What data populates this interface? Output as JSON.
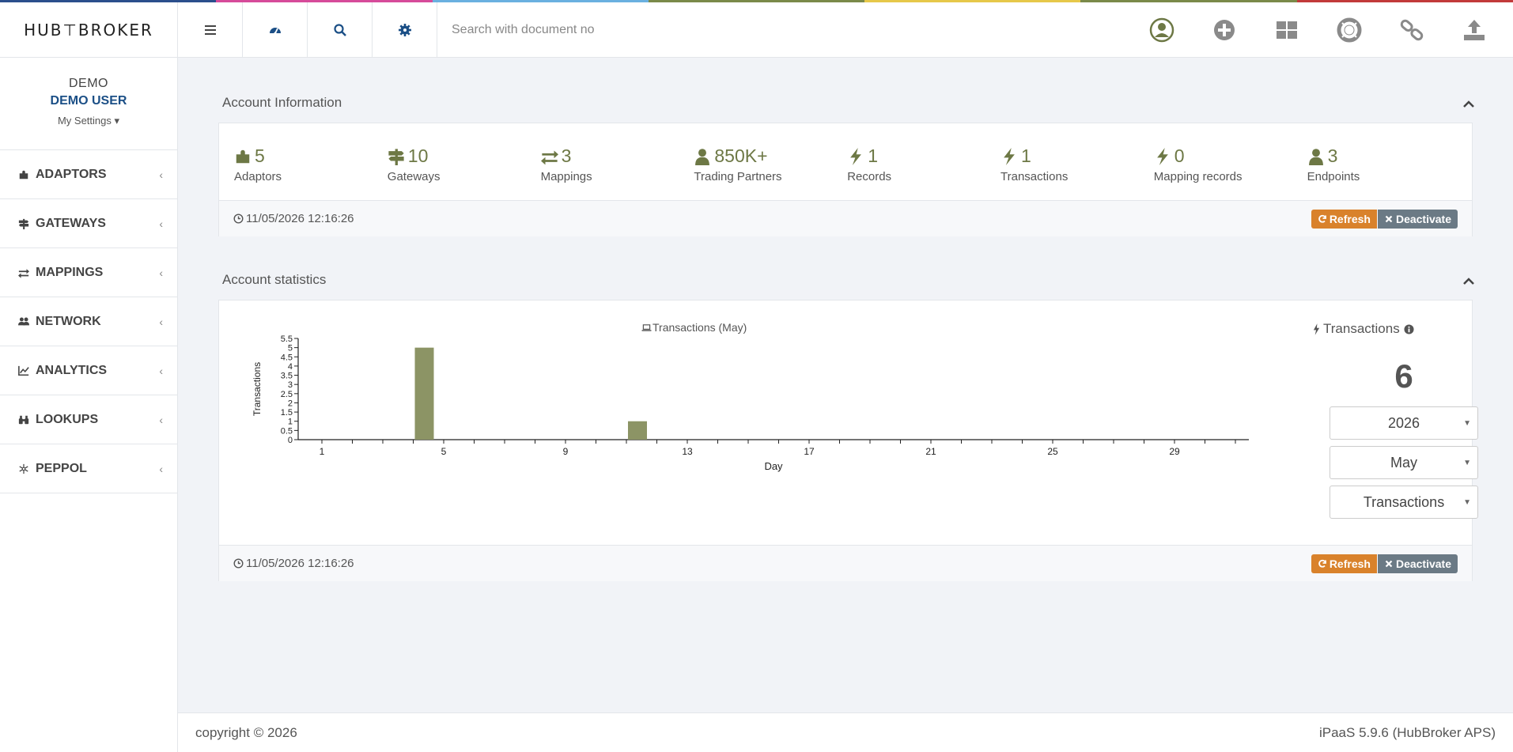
{
  "brand": {
    "logo_text": "HUB⊤BROKER"
  },
  "top_strip_colors": [
    "#2b4f8c",
    "#d64b9a",
    "#6ab0e0",
    "#7a8a4a",
    "#e6c84a",
    "#7a8a4a",
    "#c23a3a"
  ],
  "header": {
    "search_placeholder": "Search with document no",
    "left_icons": [
      "menu-icon",
      "dashboard-icon",
      "search-icon",
      "gear-icon"
    ],
    "right_icons": [
      "user-circle-icon",
      "add-circle-icon",
      "dashboard-grid-icon",
      "lifesaver-icon",
      "link-icon",
      "upload-icon"
    ]
  },
  "user": {
    "org": "DEMO",
    "name": "DEMO USER",
    "settings": "My Settings"
  },
  "sidebar": {
    "items": [
      {
        "label": "ADAPTORS",
        "icon": "puzzle-icon"
      },
      {
        "label": "GATEWAYS",
        "icon": "signpost-icon"
      },
      {
        "label": "MAPPINGS",
        "icon": "exchange-icon"
      },
      {
        "label": "NETWORK",
        "icon": "users-icon"
      },
      {
        "label": "ANALYTICS",
        "icon": "line-chart-icon"
      },
      {
        "label": "LOOKUPS",
        "icon": "binoculars-icon"
      },
      {
        "label": "PEPPOL",
        "icon": "snowflake-icon"
      }
    ]
  },
  "account_info": {
    "title": "Account Information",
    "stats": [
      {
        "value": "5",
        "label": "Adaptors",
        "icon": "puzzle-icon"
      },
      {
        "value": "10",
        "label": "Gateways",
        "icon": "signpost-icon"
      },
      {
        "value": "3",
        "label": "Mappings",
        "icon": "exchange-icon"
      },
      {
        "value": "850K+",
        "label": "Trading Partners",
        "icon": "user-icon"
      },
      {
        "value": "1",
        "label": "Records",
        "icon": "bolt-icon"
      },
      {
        "value": "1",
        "label": "Transactions",
        "icon": "bolt-icon"
      },
      {
        "value": "0",
        "label": "Mapping records",
        "icon": "bolt-icon"
      },
      {
        "value": "3",
        "label": "Endpoints",
        "icon": "user-icon"
      }
    ],
    "timestamp": "11/05/2026 12:16:26",
    "refresh_label": "Refresh",
    "deactivate_label": "Deactivate"
  },
  "account_stats": {
    "title": "Account statistics",
    "side_title": "Transactions",
    "total": "6",
    "year": "2026",
    "month": "May",
    "metric": "Transactions",
    "timestamp": "11/05/2026 12:16:26",
    "refresh_label": "Refresh",
    "deactivate_label": "Deactivate"
  },
  "chart_data": {
    "type": "bar",
    "title": "Transactions (May)",
    "xlabel": "Day",
    "ylabel": "Transactions",
    "xlim": [
      1,
      31
    ],
    "ylim": [
      0,
      5.5
    ],
    "xticks": [
      "1",
      "5",
      "9",
      "13",
      "17",
      "21",
      "25",
      "29"
    ],
    "yticks": [
      "0",
      "0.5",
      "1",
      "1.5",
      "2",
      "2.5",
      "3",
      "3.5",
      "4",
      "4.5",
      "5",
      "5.5"
    ],
    "series": [
      {
        "name": "Transactions",
        "color": "#8c9465",
        "points": [
          {
            "x": 4,
            "y": 5
          },
          {
            "x": 11,
            "y": 1
          }
        ]
      }
    ],
    "legend": "bottom-center",
    "grid": false
  },
  "footer": {
    "copyright": "copyright © 2026",
    "version": "iPaaS 5.9.6 (HubBroker APS)"
  }
}
